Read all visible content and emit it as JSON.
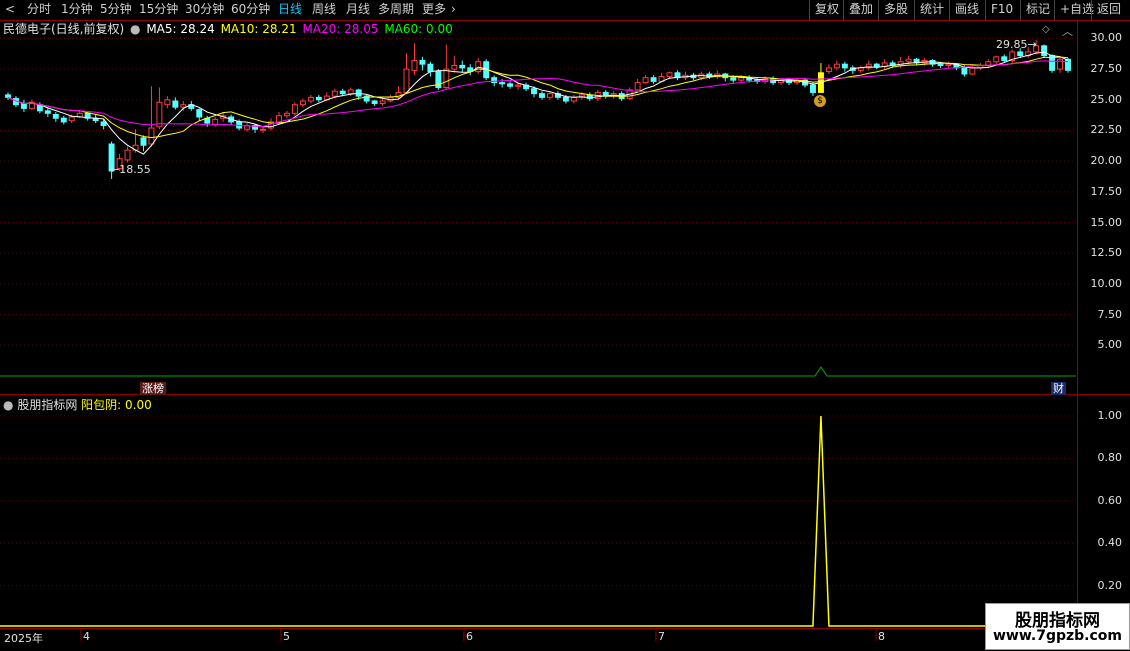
{
  "toolbar": {
    "periods": [
      "分时",
      "1分钟",
      "5分钟",
      "15分钟",
      "30分钟",
      "60分钟",
      "日线",
      "周线",
      "月线",
      "多周期",
      "更多"
    ],
    "active_period": "日线",
    "right_buttons": [
      "复权",
      "叠加",
      "多股",
      "统计",
      "画线",
      "F10",
      "标记",
      "+自选",
      "返回"
    ],
    "colors": {
      "active": "#00c8ff"
    }
  },
  "main": {
    "stock_title": "民德电子(日线,前复权)",
    "ma5_label": "MA5: 28.24",
    "ma10_label": "MA10: 28.21",
    "ma20_label": "MA20: 28.05",
    "ma60_label": "MA60: 0.00",
    "low_marker": "18.55",
    "high_marker": "29.85",
    "signal_badge": "$",
    "event_badge_left": "涨榜",
    "event_badge_right": "财",
    "y_ticks": [
      "30.00",
      "27.50",
      "25.00",
      "22.50",
      "20.00",
      "17.50",
      "15.00",
      "12.50",
      "10.00",
      "7.50",
      "5.00"
    ],
    "colors": {
      "ma5": "#ffffff",
      "ma10": "#ffff00",
      "ma20": "#ff00ff",
      "ma60": "#00ff00",
      "up": "#ff3c3c",
      "down": "#54ffff",
      "signal": "#ffff00"
    }
  },
  "indicator": {
    "name": "股朋指标网",
    "value_label": "阳包阴: 0.00",
    "y_ticks": [
      "1.00",
      "0.80",
      "0.60",
      "0.40",
      "0.20"
    ],
    "colors": {
      "line": "#ffff00"
    }
  },
  "date_axis": {
    "labels": [
      "2025年",
      "4",
      "5",
      "6",
      "7",
      "8"
    ]
  },
  "watermark": {
    "title": "股朋指标网",
    "url": "www.7gpzb.com"
  },
  "chart_data": {
    "type": "candlestick",
    "ylim": [
      2.5,
      31.5
    ],
    "candles": [
      [
        25.4,
        25.2,
        25.6,
        25.0
      ],
      [
        25.1,
        24.6,
        25.3,
        24.4
      ],
      [
        24.7,
        24.3,
        25.0,
        24.0
      ],
      [
        24.3,
        24.8,
        25.0,
        24.2
      ],
      [
        24.6,
        24.1,
        24.8,
        23.9
      ],
      [
        24.1,
        23.9,
        24.3,
        23.6
      ],
      [
        23.8,
        23.5,
        24.0,
        23.2
      ],
      [
        23.5,
        23.2,
        23.7,
        23.0
      ],
      [
        23.3,
        23.6,
        23.8,
        23.1
      ],
      [
        23.6,
        23.9,
        24.1,
        23.5
      ],
      [
        23.9,
        23.5,
        24.0,
        23.3
      ],
      [
        23.5,
        23.3,
        23.8,
        23.1
      ],
      [
        23.2,
        22.9,
        23.4,
        22.6
      ],
      [
        21.4,
        19.2,
        21.6,
        18.55
      ],
      [
        19.4,
        20.2,
        20.6,
        19.2
      ],
      [
        20.1,
        20.9,
        21.2,
        19.9
      ],
      [
        20.9,
        21.3,
        22.6,
        20.7
      ],
      [
        21.9,
        21.3,
        22.1,
        20.8
      ],
      [
        21.4,
        22.7,
        26.1,
        21.2
      ],
      [
        22.8,
        24.8,
        26.0,
        22.6
      ],
      [
        24.6,
        25.0,
        25.3,
        24.3
      ],
      [
        24.9,
        24.4,
        25.2,
        24.2
      ],
      [
        24.4,
        24.6,
        24.9,
        24.1
      ],
      [
        24.6,
        24.3,
        24.9,
        24.1
      ],
      [
        24.2,
        23.6,
        24.3,
        23.3
      ],
      [
        23.5,
        23.1,
        23.7,
        22.8
      ],
      [
        23.0,
        23.4,
        23.6,
        22.8
      ],
      [
        23.5,
        23.7,
        24.0,
        23.2
      ],
      [
        23.6,
        23.2,
        23.8,
        23.0
      ],
      [
        23.2,
        22.7,
        23.4,
        22.5
      ],
      [
        22.6,
        22.9,
        23.1,
        22.4
      ],
      [
        22.9,
        22.6,
        23.0,
        22.3
      ],
      [
        22.6,
        22.6,
        22.8,
        22.3
      ],
      [
        22.7,
        23.2,
        23.5,
        22.5
      ],
      [
        23.2,
        23.7,
        24.0,
        23.1
      ],
      [
        23.7,
        23.9,
        24.1,
        23.5
      ],
      [
        23.9,
        24.6,
        24.8,
        23.7
      ],
      [
        24.6,
        24.9,
        25.1,
        24.4
      ],
      [
        24.9,
        25.2,
        25.4,
        24.7
      ],
      [
        25.2,
        25.0,
        25.4,
        24.8
      ],
      [
        25.0,
        25.3,
        25.6,
        24.9
      ],
      [
        25.3,
        25.7,
        25.9,
        25.1
      ],
      [
        25.7,
        25.5,
        25.9,
        25.3
      ],
      [
        25.5,
        25.8,
        26.0,
        25.3
      ],
      [
        25.8,
        25.3,
        25.9,
        25.0
      ],
      [
        25.3,
        24.9,
        25.4,
        24.7
      ],
      [
        24.9,
        24.7,
        25.0,
        24.5
      ],
      [
        24.7,
        24.9,
        25.1,
        24.5
      ],
      [
        24.9,
        25.2,
        25.4,
        24.8
      ],
      [
        25.2,
        25.6,
        26.1,
        25.0
      ],
      [
        25.6,
        27.5,
        28.8,
        25.5
      ],
      [
        27.4,
        28.2,
        29.6,
        27.0
      ],
      [
        28.2,
        27.9,
        28.5,
        27.4
      ],
      [
        27.9,
        27.3,
        28.1,
        26.9
      ],
      [
        27.3,
        26.0,
        27.5,
        25.8
      ],
      [
        26.0,
        27.5,
        29.5,
        25.9
      ],
      [
        27.5,
        27.8,
        28.6,
        27.2
      ],
      [
        27.8,
        27.6,
        28.2,
        27.2
      ],
      [
        27.6,
        27.3,
        27.9,
        27.0
      ],
      [
        27.3,
        28.1,
        28.4,
        27.1
      ],
      [
        28.1,
        26.8,
        28.3,
        26.6
      ],
      [
        26.8,
        26.4,
        27.0,
        26.1
      ],
      [
        26.4,
        26.3,
        26.7,
        26.0
      ],
      [
        26.3,
        26.1,
        26.5,
        25.9
      ],
      [
        26.1,
        26.2,
        26.4,
        25.8
      ],
      [
        26.2,
        25.9,
        26.4,
        25.7
      ],
      [
        25.9,
        25.5,
        26.1,
        25.2
      ],
      [
        25.5,
        25.2,
        25.7,
        25.0
      ],
      [
        25.2,
        25.5,
        25.7,
        25.0
      ],
      [
        25.5,
        25.2,
        25.7,
        25.0
      ],
      [
        25.2,
        24.9,
        25.4,
        24.7
      ],
      [
        24.9,
        25.2,
        25.4,
        24.7
      ],
      [
        25.2,
        25.4,
        25.6,
        25.0
      ],
      [
        25.4,
        25.1,
        25.6,
        24.9
      ],
      [
        25.1,
        25.6,
        25.8,
        24.9
      ],
      [
        25.6,
        25.3,
        25.8,
        25.1
      ],
      [
        25.3,
        25.5,
        25.7,
        25.1
      ],
      [
        25.5,
        25.1,
        25.7,
        24.9
      ],
      [
        25.1,
        25.8,
        26.0,
        25.0
      ],
      [
        25.8,
        26.4,
        26.7,
        25.7
      ],
      [
        26.4,
        26.8,
        27.0,
        26.3
      ],
      [
        26.8,
        26.5,
        27.0,
        26.3
      ],
      [
        26.5,
        26.9,
        27.2,
        26.4
      ],
      [
        26.9,
        27.2,
        27.3,
        26.7
      ],
      [
        27.2,
        26.8,
        27.4,
        26.6
      ],
      [
        26.8,
        27.0,
        27.3,
        26.6
      ],
      [
        27.0,
        26.8,
        27.2,
        26.6
      ],
      [
        26.8,
        27.1,
        27.3,
        26.6
      ],
      [
        27.1,
        26.9,
        27.3,
        26.7
      ],
      [
        26.9,
        27.1,
        27.4,
        26.7
      ],
      [
        27.1,
        26.8,
        27.2,
        26.5
      ],
      [
        26.8,
        26.6,
        27.0,
        26.4
      ],
      [
        26.6,
        26.8,
        27.0,
        26.4
      ],
      [
        26.8,
        26.6,
        27.0,
        26.4
      ],
      [
        26.6,
        26.5,
        26.8,
        26.3
      ],
      [
        26.5,
        26.7,
        26.9,
        26.3
      ],
      [
        26.7,
        26.4,
        26.9,
        26.2
      ],
      [
        26.4,
        26.6,
        26.8,
        26.2
      ],
      [
        26.6,
        26.4,
        26.8,
        26.2
      ],
      [
        26.4,
        26.6,
        26.8,
        26.2
      ],
      [
        26.6,
        26.2,
        26.8,
        26.0
      ],
      [
        26.2,
        25.6,
        26.4,
        25.3
      ],
      [
        25.6,
        27.2,
        28.0,
        25.6
      ],
      [
        27.3,
        27.6,
        27.9,
        27.1
      ],
      [
        27.6,
        27.9,
        28.2,
        27.4
      ],
      [
        27.9,
        27.6,
        28.1,
        27.3
      ],
      [
        27.6,
        27.4,
        27.8,
        27.1
      ],
      [
        27.4,
        27.6,
        27.8,
        27.2
      ],
      [
        27.6,
        27.9,
        28.2,
        27.4
      ],
      [
        27.9,
        27.7,
        28.0,
        27.5
      ],
      [
        27.7,
        28.0,
        28.3,
        27.5
      ],
      [
        28.0,
        27.8,
        28.2,
        27.6
      ],
      [
        27.8,
        28.1,
        28.5,
        27.6
      ],
      [
        28.1,
        28.3,
        28.6,
        27.9
      ],
      [
        28.3,
        28.0,
        28.4,
        27.8
      ],
      [
        28.0,
        28.2,
        28.4,
        27.8
      ],
      [
        28.2,
        27.9,
        28.3,
        27.7
      ],
      [
        27.9,
        27.8,
        28.1,
        27.6
      ],
      [
        27.8,
        27.9,
        28.1,
        27.6
      ],
      [
        27.9,
        27.6,
        28.0,
        27.4
      ],
      [
        27.6,
        27.1,
        27.8,
        26.9
      ],
      [
        27.1,
        27.6,
        27.8,
        27.0
      ],
      [
        27.6,
        27.8,
        28.0,
        27.4
      ],
      [
        27.8,
        28.1,
        28.3,
        27.6
      ],
      [
        28.1,
        28.5,
        28.6,
        27.9
      ],
      [
        28.5,
        28.2,
        28.7,
        28.0
      ],
      [
        28.2,
        28.9,
        29.1,
        28.0
      ],
      [
        28.9,
        28.6,
        29.2,
        28.4
      ],
      [
        28.6,
        28.9,
        29.3,
        28.4
      ],
      [
        28.9,
        29.4,
        29.85,
        28.7
      ],
      [
        29.4,
        28.6,
        29.5,
        28.4
      ],
      [
        28.6,
        27.4,
        28.7,
        27.2
      ],
      [
        27.5,
        28.3,
        28.5,
        27.2
      ],
      [
        28.3,
        27.4,
        28.4,
        27.2
      ]
    ],
    "signal_index": 102,
    "signal_value": 1.0,
    "indicator_ylim": [
      0,
      1.05
    ]
  }
}
